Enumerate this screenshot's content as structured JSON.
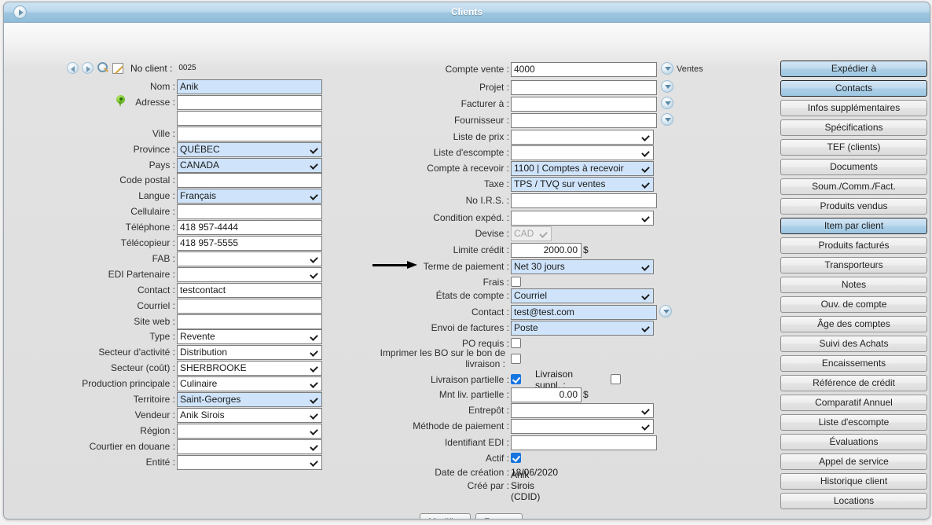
{
  "window": {
    "title": "Clients",
    "nav_button_icon": "circle-arrow-right-icon"
  },
  "toolbar": {
    "prev_icon": "previous-record-icon",
    "next_icon": "next-record-icon",
    "search_icon": "magnifier-icon",
    "edit_icon": "pencil-edit-icon",
    "no_client_label": "No client :",
    "no_client_value": "0025"
  },
  "left_column": [
    {
      "label": "Nom :",
      "value": "Anik",
      "type": "text",
      "highlight": true,
      "name": "nom"
    },
    {
      "label": "Adresse :",
      "value": "",
      "type": "text",
      "highlight": false,
      "name": "adresse",
      "icon": "map-pin-icon"
    },
    {
      "label": "",
      "value": "",
      "type": "text",
      "highlight": false,
      "name": "adresse2"
    },
    {
      "label": "Ville :",
      "value": "",
      "type": "text",
      "highlight": false,
      "name": "ville"
    },
    {
      "label": "Province :",
      "value": "QUÉBEC",
      "type": "select",
      "highlight": true,
      "name": "province"
    },
    {
      "label": "Pays :",
      "value": "CANADA",
      "type": "select",
      "highlight": true,
      "name": "pays"
    },
    {
      "label": "Code postal :",
      "value": "",
      "type": "text",
      "highlight": false,
      "name": "code-postal"
    },
    {
      "label": "Langue :",
      "value": "Français",
      "type": "select",
      "highlight": true,
      "name": "langue"
    },
    {
      "label": "Cellulaire :",
      "value": "",
      "type": "text",
      "highlight": false,
      "name": "cellulaire"
    },
    {
      "label": "Téléphone :",
      "value": "418 957-4444",
      "type": "text",
      "highlight": false,
      "name": "telephone"
    },
    {
      "label": "Télécopieur :",
      "value": "418 957-5555",
      "type": "text",
      "highlight": false,
      "name": "telecopieur"
    },
    {
      "label": "FAB :",
      "value": "",
      "type": "select",
      "highlight": false,
      "name": "fab"
    },
    {
      "label": "EDI Partenaire :",
      "value": "",
      "type": "select",
      "highlight": false,
      "name": "edi-partenaire"
    },
    {
      "label": "Contact :",
      "value": "testcontact",
      "type": "text",
      "highlight": false,
      "name": "contact"
    },
    {
      "label": "Courriel :",
      "value": "",
      "type": "text",
      "highlight": false,
      "name": "courriel"
    },
    {
      "label": "Site web :",
      "value": "",
      "type": "text",
      "highlight": false,
      "name": "site-web"
    },
    {
      "label": "Type :",
      "value": "Revente",
      "type": "select",
      "highlight": false,
      "name": "type"
    },
    {
      "label": "Secteur d'activité :",
      "value": "Distribution",
      "type": "select",
      "highlight": false,
      "name": "secteur-activite"
    },
    {
      "label": "Secteur (coût) :",
      "value": "SHERBROOKE",
      "type": "select",
      "highlight": false,
      "name": "secteur-cout"
    },
    {
      "label": "Production principale :",
      "value": "Culinaire",
      "type": "select",
      "highlight": false,
      "name": "production-principale"
    },
    {
      "label": "Territoire :",
      "value": "Saint-Georges",
      "type": "select",
      "highlight": true,
      "name": "territoire"
    },
    {
      "label": "Vendeur :",
      "value": "Anik Sirois",
      "type": "select",
      "highlight": false,
      "name": "vendeur"
    },
    {
      "label": "Région :",
      "value": "",
      "type": "select",
      "highlight": false,
      "name": "region"
    },
    {
      "label": "Courtier en douane :",
      "value": "",
      "type": "select",
      "highlight": false,
      "name": "courtier-en-douane"
    },
    {
      "label": "Entité :",
      "value": "",
      "type": "select",
      "highlight": false,
      "name": "entite"
    }
  ],
  "middle_column": {
    "compte_vente": {
      "label": "Compte vente :",
      "value": "4000",
      "aux_label": "Ventes"
    },
    "projet": {
      "label": "Projet :",
      "value": ""
    },
    "facturer_a": {
      "label": "Facturer à :",
      "value": ""
    },
    "fournisseur": {
      "label": "Fournisseur :",
      "value": ""
    },
    "liste_de_prix": {
      "label": "Liste de prix :",
      "value": ""
    },
    "liste_descompte": {
      "label": "Liste d'escompte :",
      "value": ""
    },
    "compte_a_recevoir": {
      "label": "Compte à recevoir :",
      "value": "1100 | Comptes à recevoir"
    },
    "taxe": {
      "label": "Taxe :",
      "value": "TPS / TVQ sur ventes"
    },
    "no_irs": {
      "label": "No I.R.S. :",
      "value": ""
    },
    "condition_exped": {
      "label": "Condition expéd. :",
      "value": ""
    },
    "devise": {
      "label": "Devise :",
      "value": "CAD"
    },
    "limite_credit": {
      "label": "Limite crédit :",
      "value": "2000.00",
      "suffix": "$"
    },
    "terme_de_paiement": {
      "label": "Terme de paiement :",
      "value": "Net 30 jours"
    },
    "frais": {
      "label": "Frais :",
      "checked": false
    },
    "etats_de_compte": {
      "label": "États de compte :",
      "value": "Courriel"
    },
    "contact": {
      "label": "Contact :",
      "value": "test@test.com"
    },
    "envoi_de_factures": {
      "label": "Envoi de factures :",
      "value": "Poste"
    },
    "po_requis": {
      "label": "PO requis :",
      "checked": false
    },
    "imprimer_bo": {
      "label": "Imprimer les BO sur le bon de livraison :",
      "checked": false
    },
    "livraison_partielle": {
      "label": "Livraison partielle :",
      "checked": true
    },
    "livraison_suppl": {
      "label": "Livraison suppl. :",
      "checked": false
    },
    "mnt_liv_partielle": {
      "label": "Mnt liv. partielle :",
      "value": "0.00",
      "suffix": "$"
    },
    "entrepot": {
      "label": "Entrepôt :",
      "value": ""
    },
    "methode_de_paiement": {
      "label": "Méthode de paiement :",
      "value": ""
    },
    "identifiant_edi": {
      "label": "Identifiant EDI :",
      "value": ""
    },
    "actif": {
      "label": "Actif :",
      "checked": true
    },
    "date_de_creation": {
      "label": "Date de création :",
      "value": "18/06/2020"
    },
    "cree_par": {
      "label": "Créé par :",
      "value": "Anik Sirois (CDID)"
    }
  },
  "side_buttons": [
    {
      "label": "Expédier à",
      "active": true
    },
    {
      "label": "Contacts",
      "active": true
    },
    {
      "label": "Infos supplémentaires",
      "active": false
    },
    {
      "label": "Spécifications",
      "active": false
    },
    {
      "label": "TEF (clients)",
      "active": false
    },
    {
      "label": "Documents",
      "active": false
    },
    {
      "label": "Soum./Comm./Fact.",
      "active": false
    },
    {
      "label": "Produits vendus",
      "active": false
    },
    {
      "label": "Item par client",
      "active": true
    },
    {
      "label": "Produits facturés",
      "active": false
    },
    {
      "label": "Transporteurs",
      "active": false
    },
    {
      "label": "Notes",
      "active": false
    },
    {
      "label": "Ouv. de compte",
      "active": false
    },
    {
      "label": "Âge des comptes",
      "active": false
    },
    {
      "label": "Suivi des Achats",
      "active": false
    },
    {
      "label": "Encaissements",
      "active": false
    },
    {
      "label": "Référence de crédit",
      "active": false
    },
    {
      "label": "Comparatif Annuel",
      "active": false
    },
    {
      "label": "Liste d'escompte",
      "active": false
    },
    {
      "label": "Évaluations",
      "active": false
    },
    {
      "label": "Appel de service",
      "active": false
    },
    {
      "label": "Historique client",
      "active": false
    },
    {
      "label": "Locations",
      "active": false
    }
  ],
  "bottom_buttons": [
    {
      "label": "Modifier"
    },
    {
      "label": "Fermer"
    }
  ],
  "annotation": {
    "type": "arrow",
    "points_to": "Terme de paiement"
  },
  "colors": {
    "titlebar_accent": "#9ec6e0",
    "field_highlight": "#cfe4fa",
    "checkbox_checked": "#1675e0",
    "window_bg": "#dedede"
  }
}
